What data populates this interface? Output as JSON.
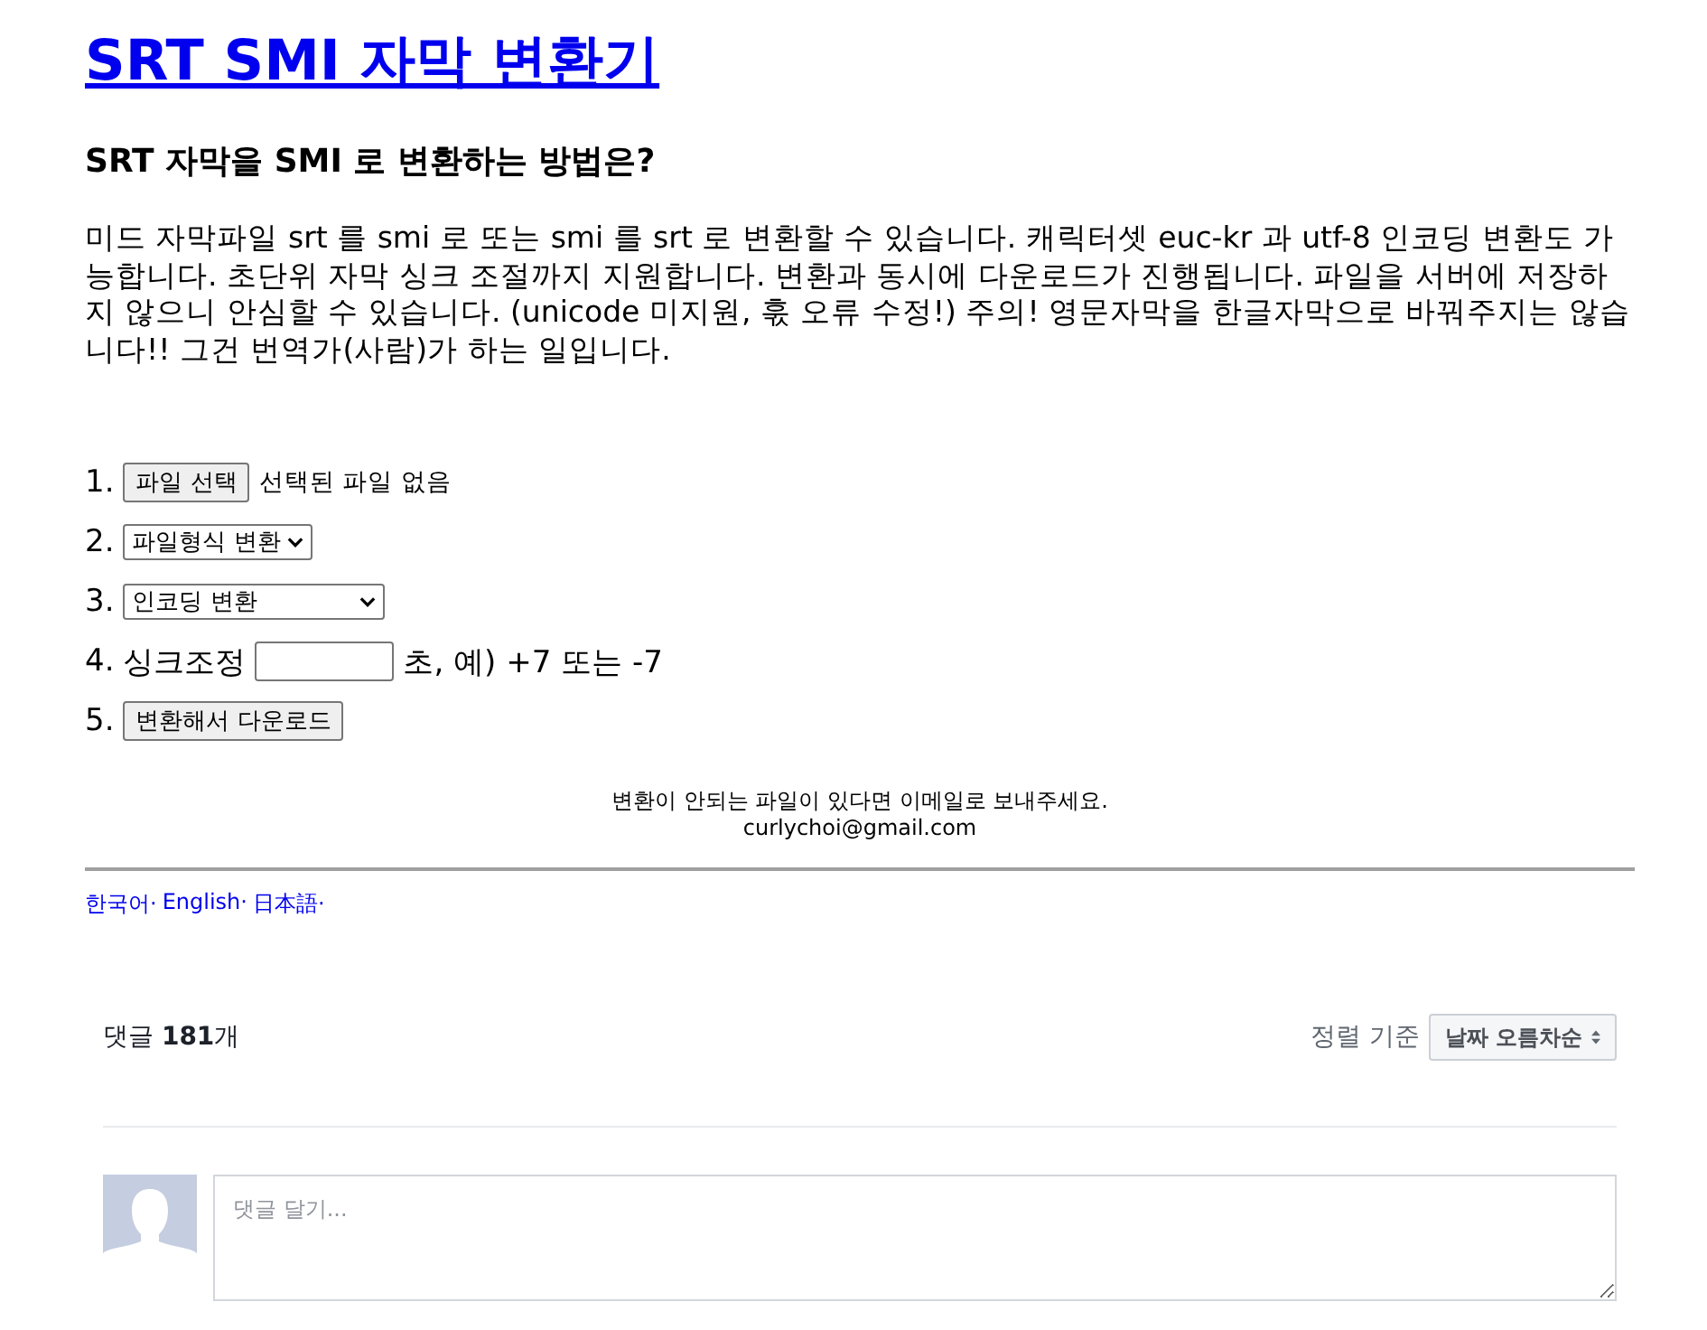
{
  "title": {
    "text": "SRT SMI 자막 변환기"
  },
  "heading": "SRT 자막을 SMI 로 변환하는 방법은?",
  "description": "미드 자막파일 srt 를 smi 로 또는 smi 를 srt 로 변환할 수 있습니다. 캐릭터셋 euc-kr 과 utf-8 인코딩 변환도 가능합니다. 초단위 자막 싱크 조절까지 지원합니다. 변환과 동시에 다운로드가 진행됩니다. 파일을 서버에 저장하지 않으니 안심할 수 있습니다. (unicode 미지원, 훇 오류 수정!) 주의! 영문자막을 한글자막으로 바꿔주지는 않습니다!! 그건 번역가(사람)가 하는 일입니다.",
  "steps": [
    {
      "number": "1.",
      "kind": "file",
      "button": "파일 선택",
      "status": "선택된 파일 없음"
    },
    {
      "number": "2.",
      "kind": "select",
      "value": "파일형식 변환"
    },
    {
      "number": "3.",
      "kind": "select",
      "value": "인코딩 변환"
    },
    {
      "number": "4.",
      "kind": "input",
      "label": "싱크조정",
      "suffix": "초, 예) +7 또는 -7"
    },
    {
      "number": "5.",
      "kind": "button",
      "button": "변환해서 다운로드"
    }
  ],
  "contact": {
    "message": "변환이 안되는 파일이 있다면 이메일로 보내주세요.",
    "email": "curlychoi@gmail.com"
  },
  "languages": [
    "한국어·",
    "English·",
    "日本語·"
  ],
  "comments": {
    "count_label": "댓글 **181**개",
    "sort_label": "정렬 기준",
    "sort_value": "날짜 오름차순",
    "placeholder": "댓글 달기..."
  }
}
